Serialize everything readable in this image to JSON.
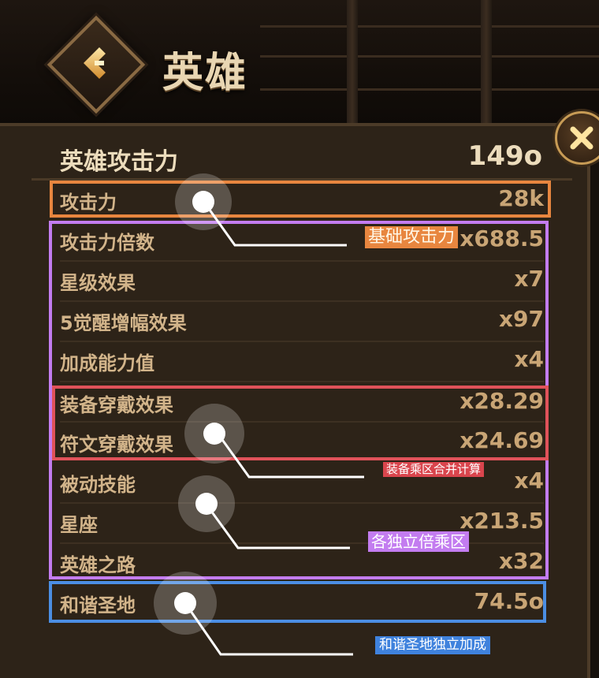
{
  "header": {
    "title": "英雄",
    "back_icon": "chevron-left-icon",
    "close_icon": "close-icon"
  },
  "summary": {
    "label": "英雄攻击力",
    "value": "149o"
  },
  "stats": [
    {
      "label": "攻击力",
      "value": "28k"
    },
    {
      "label": "攻击力倍数",
      "value": "x688.5"
    },
    {
      "label": "星级效果",
      "value": "x7"
    },
    {
      "label": "5觉醒增幅效果",
      "value": "x97"
    },
    {
      "label": "加成能力值",
      "value": "x4"
    },
    {
      "label": "装备穿戴效果",
      "value": "x28.29"
    },
    {
      "label": "符文穿戴效果",
      "value": "x24.69"
    },
    {
      "label": "被动技能",
      "value": "x4"
    },
    {
      "label": "星座",
      "value": "x213.5"
    },
    {
      "label": "英雄之路",
      "value": "x32"
    },
    {
      "label": "和谐圣地",
      "value": "74.5o"
    }
  ],
  "annotations": {
    "base_attack": "基础攻击力",
    "equipment_combined": "装备乘区合并计算",
    "independent_multipliers": "各独立倍乘区",
    "harmony_sanctuary": "和谐圣地独立加成"
  },
  "colors": {
    "orange": "#e8863f",
    "purple": "#c37cf0",
    "red": "#e0525a",
    "blue": "#4b8ee3"
  }
}
